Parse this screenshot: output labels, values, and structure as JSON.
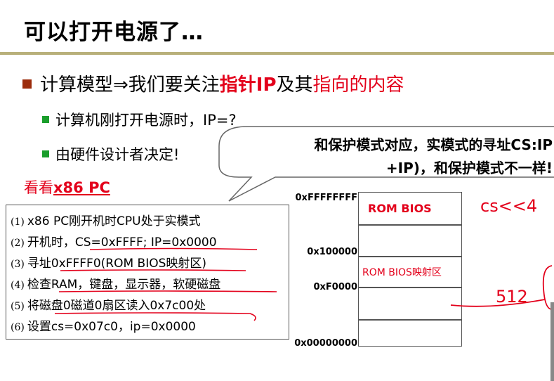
{
  "title": "可以打开电源了…",
  "main_bullet": {
    "pre": "计算模型⇒我们要关注",
    "red1": "指针IP",
    "mid": "及其",
    "red2": "指向的内容"
  },
  "sub_bullets": [
    "计算机刚打开电源时，IP=?",
    "由硬件设计者决定!"
  ],
  "see_label": {
    "prefix": "看看",
    "bold": "x86 PC"
  },
  "callout": {
    "line1": "和保护模式对应，实模式的寻址CS:IP",
    "line2": "+IP)，和保护模式不一样!"
  },
  "steps": [
    {
      "num": "(1)",
      "text": "x86 PC刚开机时CPU处于实模式"
    },
    {
      "num": "(2)",
      "text": "开机时，CS=0xFFFF; IP=0x0000"
    },
    {
      "num": "(3)",
      "text": "寻址0xFFFF0(ROM BIOS映射区)"
    },
    {
      "num": "(4)",
      "text": "检查RAM，键盘，显示器，软硬磁盘"
    },
    {
      "num": "(5)",
      "text": "将磁盘0磁道0扇区读入0x7c00处"
    },
    {
      "num": "(6)",
      "text": "设置cs=0x07c0，ip=0x0000"
    }
  ],
  "memory_map": {
    "regions": [
      "ROM BIOS",
      "ROM BIOS映射区"
    ],
    "addresses": [
      "0xFFFFFFFF",
      "0x100000",
      "0xF0000",
      "0x00000000"
    ]
  },
  "handwriting": {
    "cs_note": "cs<<4",
    "size_note": "512"
  },
  "colors": {
    "accent_red": "#e3001b",
    "bullet_brown": "#9c2c0c",
    "bullet_green": "#1a9e2c",
    "rule": "#b8b07a"
  }
}
